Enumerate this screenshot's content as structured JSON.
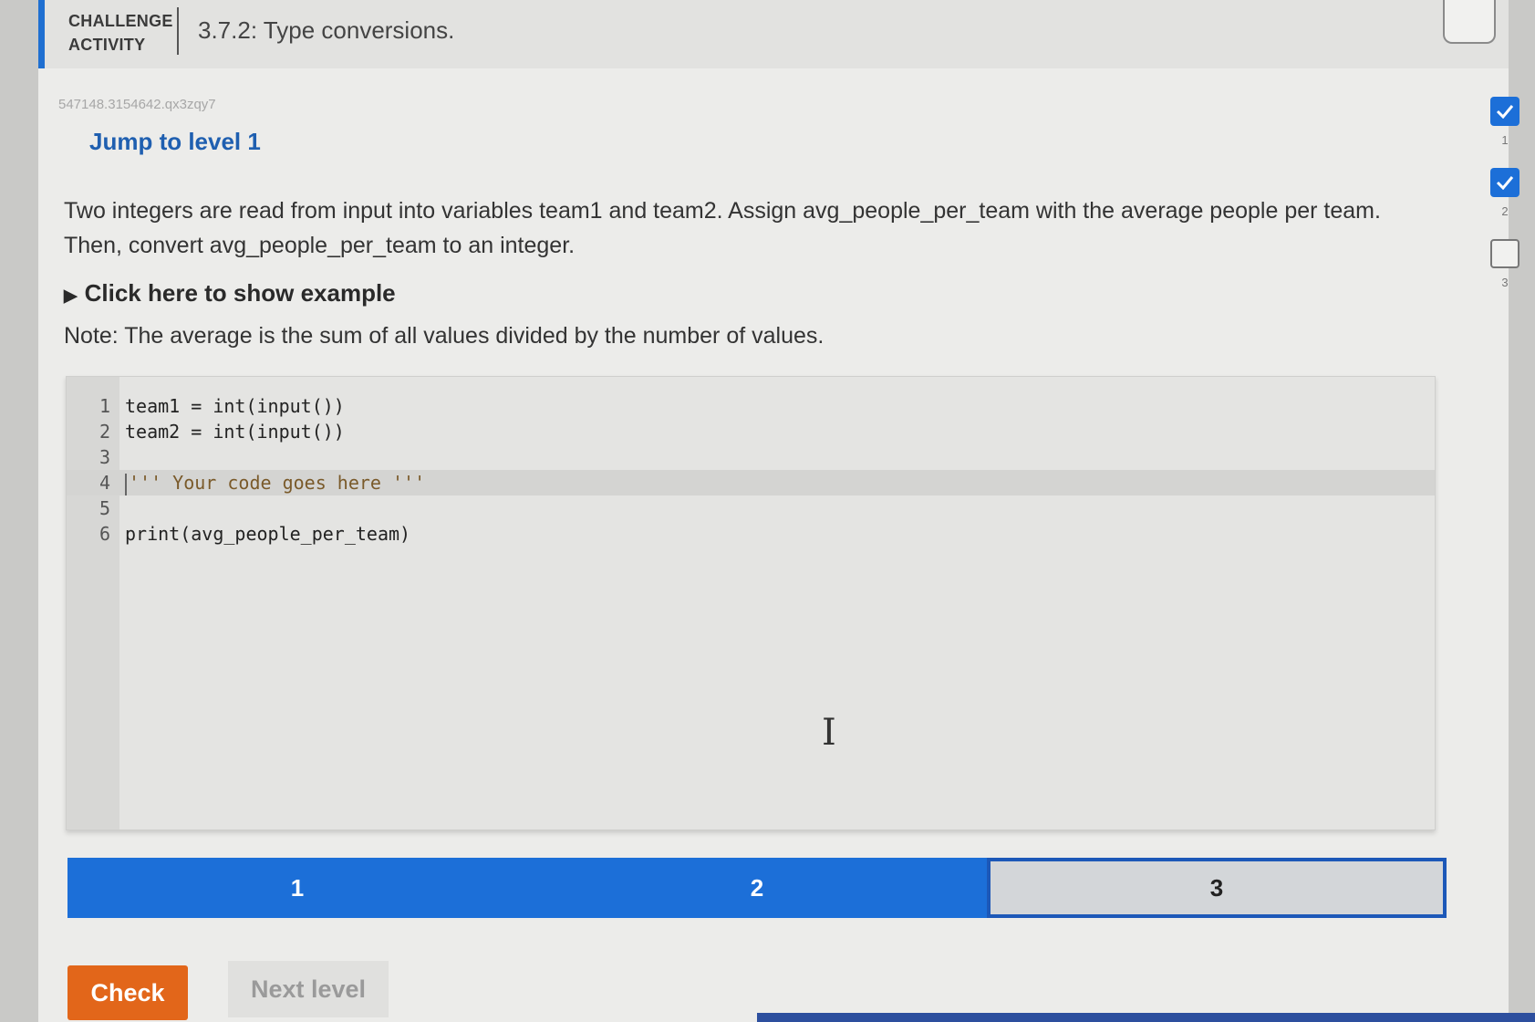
{
  "header": {
    "label_line1": "CHALLENGE",
    "label_line2": "ACTIVITY",
    "title": "3.7.2: Type conversions."
  },
  "activity_id": "547148.3154642.qx3zqy7",
  "jump_link": "Jump to level 1",
  "prompt": "Two integers are read from input into variables team1 and team2. Assign avg_people_per_team with the average people per team. Then, convert avg_people_per_team to an integer.",
  "example_toggle": "Click here to show example",
  "note": "Note: The average is the sum of all values divided by the number of values.",
  "editor": {
    "lines": [
      {
        "num": "1",
        "code": "team1 = int(input())"
      },
      {
        "num": "2",
        "code": "team2 = int(input())"
      },
      {
        "num": "3",
        "code": ""
      },
      {
        "num": "4",
        "code": "''' Your code goes here '''"
      },
      {
        "num": "5",
        "code": ""
      },
      {
        "num": "6",
        "code": "print(avg_people_per_team)"
      }
    ],
    "active_line": 4
  },
  "progress": {
    "levels": [
      "1",
      "2",
      "3"
    ],
    "completed": 2,
    "current": 3
  },
  "buttons": {
    "check": "Check",
    "next_level": "Next level"
  },
  "level_checkboxes": [
    {
      "label": "1",
      "checked": true
    },
    {
      "label": "2",
      "checked": true
    },
    {
      "label": "3",
      "checked": false
    }
  ],
  "colors": {
    "accent_blue": "#1c6fd8",
    "check_orange": "#e2661a",
    "link_blue": "#1f5fb0"
  }
}
